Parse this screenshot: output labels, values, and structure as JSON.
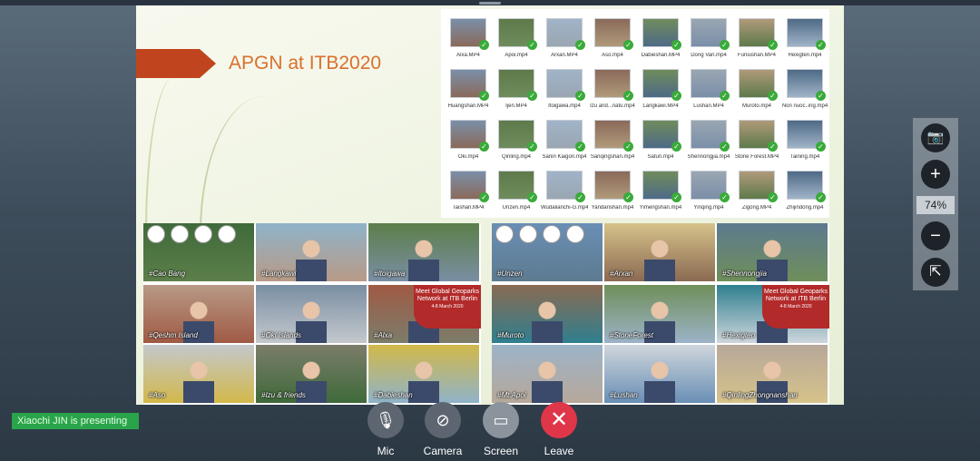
{
  "slide": {
    "title": "APGN at ITB2020"
  },
  "files": [
    {
      "name": "Alxa.MP4"
    },
    {
      "name": "Apoi.mp4"
    },
    {
      "name": "Arxan.MP4"
    },
    {
      "name": "Aso.mp4"
    },
    {
      "name": "Dabieshan.MP4"
    },
    {
      "name": "Dong Van.mp4"
    },
    {
      "name": "Funiushan.MP4"
    },
    {
      "name": "Hexigten.mp4"
    },
    {
      "name": "Huangshan.MP4"
    },
    {
      "name": "Ijen.MP4"
    },
    {
      "name": "Itoigawa.mp4"
    },
    {
      "name": "Izu and...natu.mp4"
    },
    {
      "name": "Langkawi.MP4"
    },
    {
      "name": "Lushan.MP4"
    },
    {
      "name": "Muroto.mp4"
    },
    {
      "name": "Non nuoc..ing.mp4"
    },
    {
      "name": "Oki.mp4"
    },
    {
      "name": "Qinling.mp4"
    },
    {
      "name": "Sanin Kaigon.mp4"
    },
    {
      "name": "Sanqingshan.mp4"
    },
    {
      "name": "Satun.mp4"
    },
    {
      "name": "Shennongjia.mp4"
    },
    {
      "name": "Stone Forest.MP4"
    },
    {
      "name": "Taining.mp4"
    },
    {
      "name": "Taishan.MP4"
    },
    {
      "name": "Unzen.mp4"
    },
    {
      "name": "Wudalianchi-G.mp4"
    },
    {
      "name": "Yandanshan.mp4"
    },
    {
      "name": "Yimengshan.mp4"
    },
    {
      "name": "Yinqing.mp4"
    },
    {
      "name": "Zigong.MP4"
    },
    {
      "name": "Zhijindong.mp4"
    }
  ],
  "collage_left": {
    "tags": [
      "#Cao Bang",
      "#Langkawi",
      "#Itoigawa",
      "#Qeshm Island",
      "#Oki Islands",
      "#Alxa",
      "#Aso",
      "#Izu & friends",
      "#Dabieshan"
    ],
    "meet_text": "Meet Global Geoparks Network at ITB Berlin",
    "meet_date": "4-8 March 2020"
  },
  "collage_right": {
    "tags": [
      "#Unzen",
      "#Arxan",
      "#Shennongjia",
      "#Muroto",
      "#StoneForest",
      "#Hexigten",
      "#Mt.Apoi",
      "#Lushan",
      "#QinlingZhongnanshan"
    ],
    "meet_text": "Meet Global Geoparks Network at ITB Berlin",
    "meet_date": "4-8 March 2020"
  },
  "zoom": {
    "level": "74%",
    "icons": [
      "camera-icon",
      "zoom-in-icon",
      "zoom-out-icon",
      "popout-icon"
    ]
  },
  "status": {
    "presenter": "Xiaochi JIN is presenting"
  },
  "controls": {
    "mic": "Mic",
    "camera": "Camera",
    "screen": "Screen",
    "leave": "Leave"
  },
  "colors": {
    "slide_accent": "#c0451f",
    "title": "#d9702d",
    "status_bg": "#2aa44a",
    "leave": "#e0364a"
  }
}
